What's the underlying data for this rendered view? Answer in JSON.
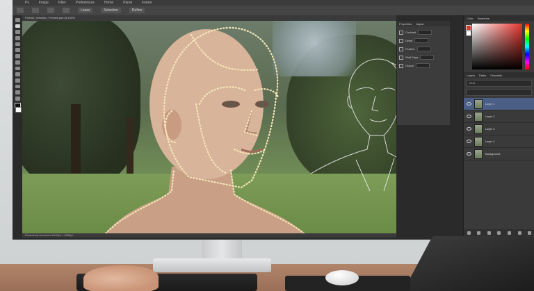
{
  "menubar": {
    "items": [
      "Ps",
      "Image",
      "Filter",
      "Preferences",
      "Home",
      "Panel",
      "Frame"
    ]
  },
  "optionbar": {
    "controls": [
      "Lasso",
      "Selection",
      "Refine"
    ]
  },
  "canvas": {
    "tab_label": "Portrait_Selection_Preview.psd @ 100%",
    "status_text": "Photoshop document  5120px x 2880px"
  },
  "properties": {
    "tabs": [
      "Properties",
      "Adjust"
    ],
    "rows": [
      "Contrast",
      "Detail",
      "Feather",
      "Shift Edge",
      "Output"
    ]
  },
  "right_panel": {
    "color_tabs": [
      "Color",
      "Swatches"
    ],
    "layer_tabs": [
      "Layers",
      "Paths",
      "Channels"
    ],
    "layer_filter": "Kind",
    "layers": [
      {
        "name": "Layer 1",
        "selected": true
      },
      {
        "name": "Layer 2",
        "selected": false
      },
      {
        "name": "Layer 3",
        "selected": false
      },
      {
        "name": "Layer 4",
        "selected": false
      },
      {
        "name": "Background",
        "selected": false
      }
    ]
  },
  "colors": {
    "accent_red": "#e8352e",
    "selection_dots": "#f5e5b8",
    "ui_dark": "#3a3a3a",
    "layer_selected": "#4b5f86"
  }
}
